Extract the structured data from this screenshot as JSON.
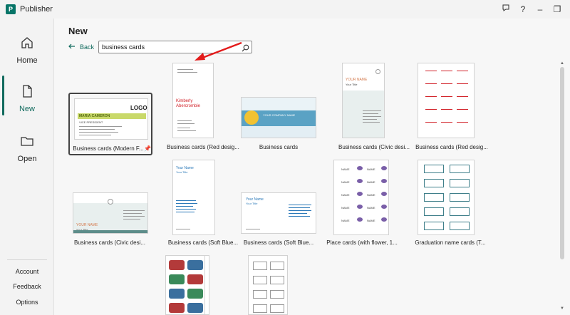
{
  "window": {
    "app_name": "Publisher",
    "help_label": "?",
    "minimize_label": "–",
    "restore_label": "❐"
  },
  "sidebar": {
    "home_label": "Home",
    "new_label": "New",
    "open_label": "Open",
    "account_label": "Account",
    "feedback_label": "Feedback",
    "options_label": "Options"
  },
  "main": {
    "title": "New",
    "back_label": "Back",
    "search_value": "business cards"
  },
  "templates": [
    {
      "caption": "Business cards (Modern F...",
      "selected": true
    },
    {
      "caption": "Business cards (Red desig..."
    },
    {
      "caption": "Business cards"
    },
    {
      "caption": "Business cards (Civic desi..."
    },
    {
      "caption": "Business cards (Red desig..."
    },
    {
      "caption": "Business cards (Civic desi..."
    },
    {
      "caption": "Business cards (Soft Blue..."
    },
    {
      "caption": "Business cards (Soft Blue..."
    },
    {
      "caption": "Place cards (with flower, 1..."
    },
    {
      "caption": "Graduation name cards (T..."
    }
  ],
  "thumb_text": {
    "modern_name": "MARIA CAMERON",
    "modern_role": "VICE PRESIDENT",
    "modern_logo": "LOGO",
    "red_name1": "Kimberly",
    "red_name2": "Abercrombie",
    "blue_company": "YOUR COMPANY NAME",
    "civic_name": "YOUR NAME",
    "civic_title": "Your Title",
    "soft_name": "Your Name",
    "soft_title": "Your Title",
    "place_name": "NAME"
  },
  "colors": {
    "accent": "#106a5d",
    "red": "#d2232a",
    "arrow": "#e31b1b"
  }
}
